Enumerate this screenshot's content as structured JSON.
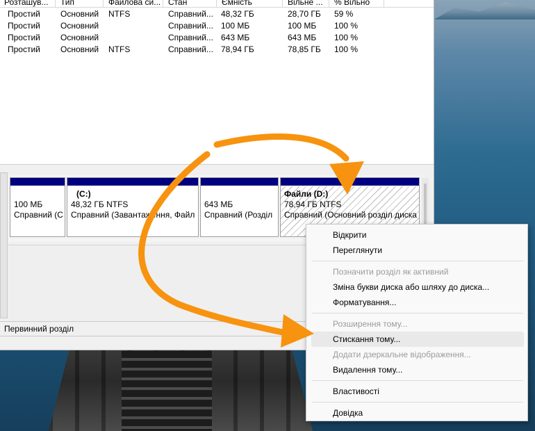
{
  "volume_list": {
    "columns": [
      "Розташув...",
      "Тип",
      "Файлова си...",
      "Стан",
      "Ємність",
      "Вільне ...",
      "% Вільно"
    ],
    "rows": [
      [
        "Простий",
        "Основний",
        "NTFS",
        "Справний...",
        "48,32 ГБ",
        "28,70 ГБ",
        "59 %"
      ],
      [
        "Простий",
        "Основний",
        "",
        "Справний...",
        "100 МБ",
        "100 МБ",
        "100 %"
      ],
      [
        "Простий",
        "Основний",
        "",
        "Справний...",
        "643 МБ",
        "643 МБ",
        "100 %"
      ],
      [
        "Простий",
        "Основний",
        "NTFS",
        "Справний...",
        "78,94 ГБ",
        "78,85 ГБ",
        "100 %"
      ]
    ]
  },
  "partitions": [
    {
      "name": "",
      "size": "100 МБ",
      "status": "Справний (С"
    },
    {
      "name": "(C:)",
      "size": "48,32 ГБ NTFS",
      "status": "Справний (Завантаження, Файл"
    },
    {
      "name": "",
      "size": "643 МБ",
      "status": "Справний (Розділ"
    },
    {
      "name": "Файли  (D:)",
      "size": "78,94 ГБ NTFS",
      "status": "Справний (Основний розділ диска"
    }
  ],
  "legend": {
    "primary_partition": "Первинний розділ"
  },
  "context_menu": {
    "open": "Відкрити",
    "explore": "Переглянути",
    "mark_active": "Позначити розділ як активний",
    "change_letter": "Зміна букви диска або шляху до диска...",
    "format": "Форматування...",
    "extend": "Розширення тому...",
    "shrink": "Стискання тому...",
    "add_mirror": "Додати дзеркальне відображення...",
    "delete": "Видалення тому...",
    "properties": "Властивості",
    "help": "Довідка"
  },
  "colors": {
    "partition_bar": "#00007f",
    "annotation_arrow": "#f7930f"
  }
}
